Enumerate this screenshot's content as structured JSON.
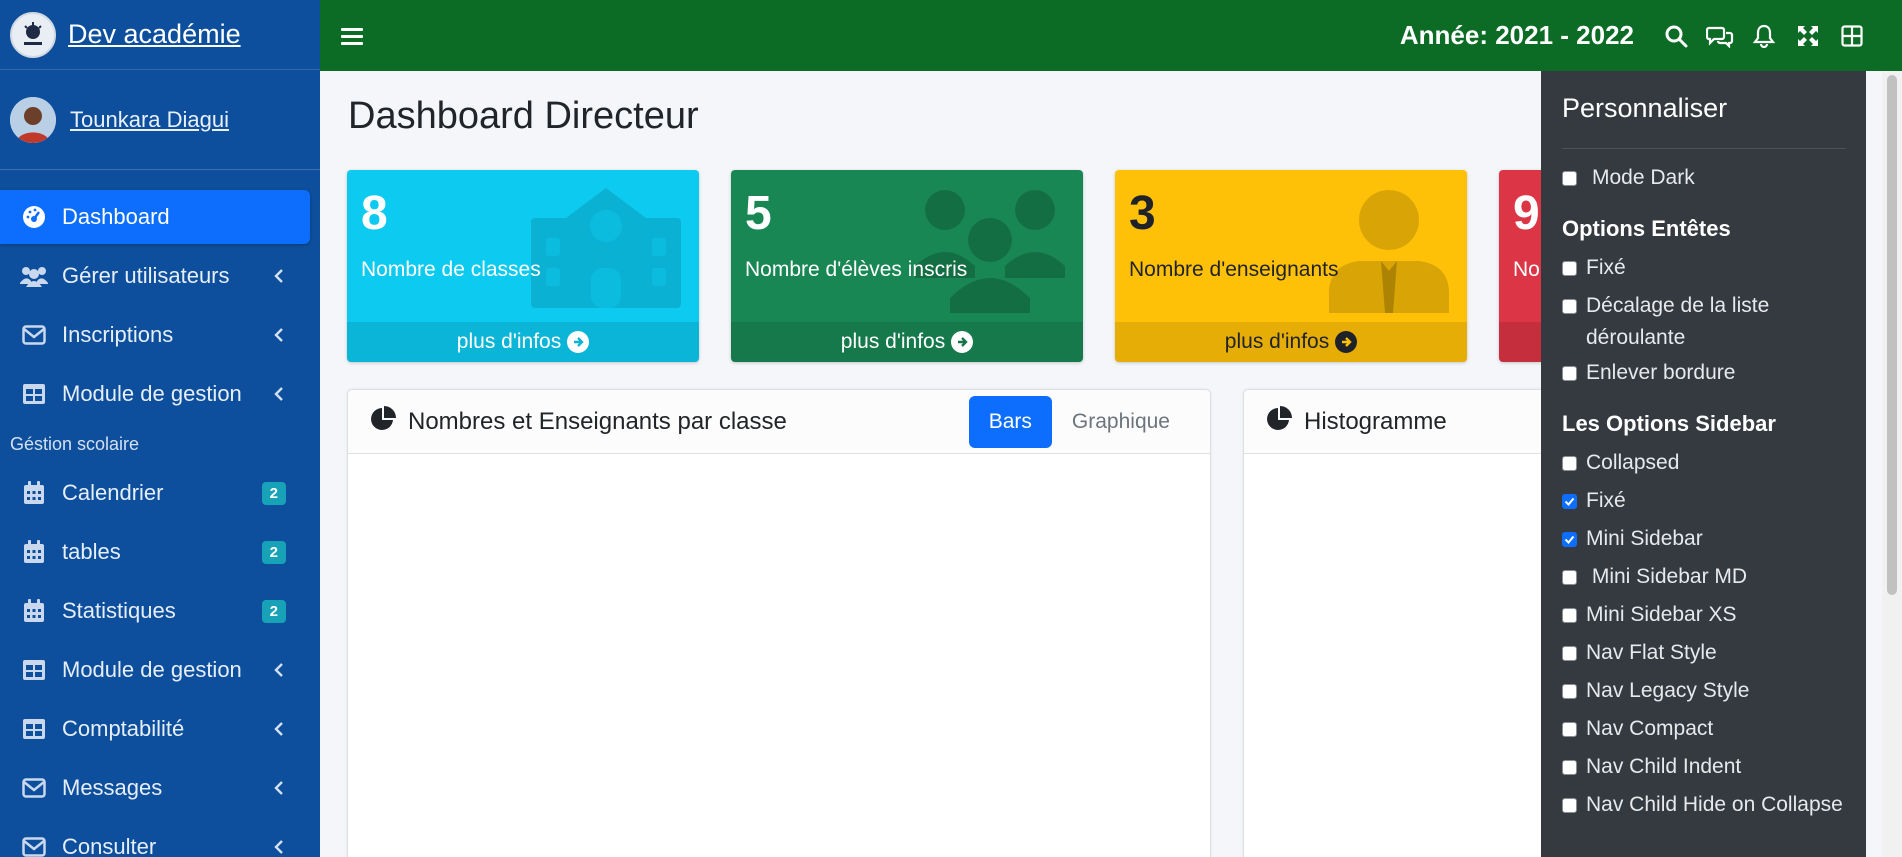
{
  "brand": {
    "name": "Dev académie"
  },
  "user": {
    "name": "Tounkara Diagui"
  },
  "sidebar": {
    "items_top": [
      {
        "label": "Dashboard",
        "icon": "dashboard-icon",
        "active": true
      },
      {
        "label": "Gérer utilisateurs",
        "icon": "users-icon",
        "chevron": true
      },
      {
        "label": "Inscriptions",
        "icon": "envelope-icon",
        "chevron": true
      },
      {
        "label": "Module de gestion",
        "icon": "table-icon",
        "chevron": true
      }
    ],
    "section_header": "Géstion scolaire",
    "items_bottom": [
      {
        "label": "Calendrier",
        "icon": "calendar-icon",
        "badge": "2"
      },
      {
        "label": "tables",
        "icon": "calendar-icon",
        "badge": "2"
      },
      {
        "label": "Statistiques",
        "icon": "calendar-icon",
        "badge": "2"
      },
      {
        "label": "Module de gestion",
        "icon": "table-icon",
        "chevron": true
      },
      {
        "label": "Comptabilité",
        "icon": "table-icon",
        "chevron": true
      },
      {
        "label": "Messages",
        "icon": "envelope-icon",
        "chevron": true
      },
      {
        "label": "Consulter",
        "icon": "envelope-icon",
        "chevron": true
      }
    ]
  },
  "topbar": {
    "year": "Année: 2021 - 2022"
  },
  "page": {
    "title": "Dashboard Directeur"
  },
  "stats": [
    {
      "value": "8",
      "label": "Nombre de classes",
      "link": "plus d'infos",
      "color": "#0dcaf0",
      "icon": "school-icon"
    },
    {
      "value": "5",
      "label": "Nombre d'élèves inscris",
      "link": "plus d'infos",
      "color": "#198754",
      "icon": "users-icon"
    },
    {
      "value": "3",
      "label": "Nombre d'enseignants",
      "link": "plus d'infos",
      "color": "#ffc107",
      "icon": "teacher-icon"
    },
    {
      "value": "9",
      "label": "No",
      "link": "",
      "color": "#dc3545",
      "icon": ""
    }
  ],
  "cards": {
    "left": {
      "title": "Nombres et Enseignants par classe",
      "tab_active": "Bars",
      "tab_other": "Graphique"
    },
    "right": {
      "title": "Histogramme"
    }
  },
  "panel": {
    "title": "Personnaliser",
    "dark_mode": "Mode Dark",
    "header_section": "Options Entêtes",
    "header_options": [
      {
        "label": "Fixé",
        "checked": false
      },
      {
        "label": "Décalage de la liste déroulante",
        "checked": false
      },
      {
        "label": "Enlever bordure",
        "checked": false
      }
    ],
    "sidebar_section": "Les Options Sidebar",
    "sidebar_options": [
      {
        "label": "Collapsed",
        "checked": false
      },
      {
        "label": "Fixé",
        "checked": true
      },
      {
        "label": "Mini Sidebar",
        "checked": true
      },
      {
        "label": " Mini Sidebar MD",
        "checked": false
      },
      {
        "label": "Mini Sidebar XS",
        "checked": false
      },
      {
        "label": "Nav Flat Style",
        "checked": false
      },
      {
        "label": "Nav Legacy Style",
        "checked": false
      },
      {
        "label": "Nav Compact",
        "checked": false
      },
      {
        "label": "Nav Child Indent",
        "checked": false
      },
      {
        "label": "Nav Child Hide on Collapse",
        "checked": false
      }
    ]
  },
  "colors": {
    "sidebar": "#0d4f9c",
    "topbar": "#0c6b24",
    "accent": "#0d6efd",
    "panel": "#343a40"
  }
}
